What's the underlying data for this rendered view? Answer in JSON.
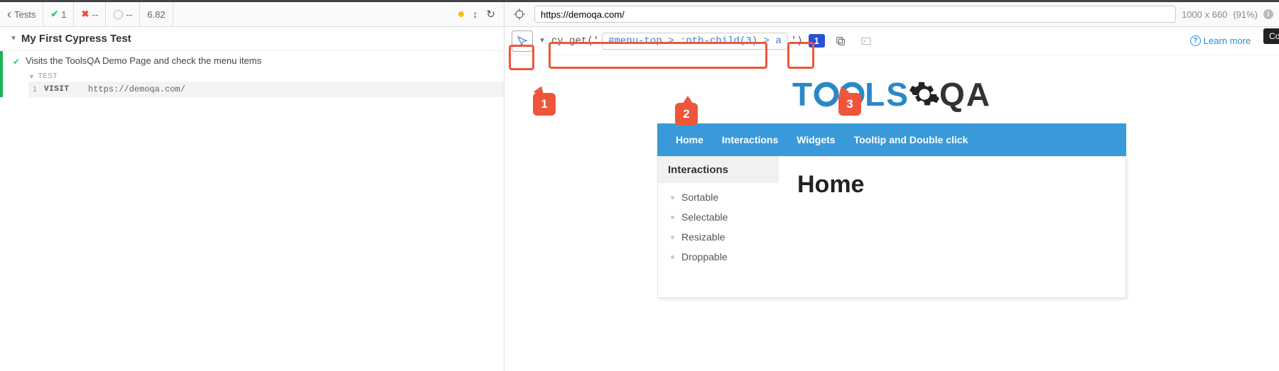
{
  "toolbar": {
    "back_label": "Tests",
    "pass_count": "1",
    "fail_count": "--",
    "pending_count": "--",
    "duration": "6.82"
  },
  "spec": {
    "title": "My First Cypress Test",
    "test_title": "Visits the ToolsQA Demo Page and check the menu items",
    "section_label": "TEST",
    "commands": [
      {
        "num": "1",
        "name": "VISIT",
        "message": "https://demoqa.com/"
      }
    ]
  },
  "url_bar": {
    "url": "https://demoqa.com/",
    "viewport": "1000 x 660",
    "scale": "(91%)"
  },
  "selector": {
    "prefix": "cy.get('",
    "value": "#menu-top > :nth-child(3) > a",
    "suffix": "')",
    "count": "1",
    "tooltip": "Copy to clipboard",
    "learn_more": "Learn more"
  },
  "preview": {
    "logo_part1": "T",
    "logo_part2": "LS",
    "logo_part3": "QA",
    "nav": [
      "Home",
      "Interactions",
      "Widgets",
      "Tooltip and Double click"
    ],
    "sidebar_title": "Interactions",
    "sidebar_items": [
      "Sortable",
      "Selectable",
      "Resizable",
      "Droppable"
    ],
    "page_title": "Home"
  },
  "callouts": {
    "c1": "1",
    "c2": "2",
    "c3": "3"
  }
}
